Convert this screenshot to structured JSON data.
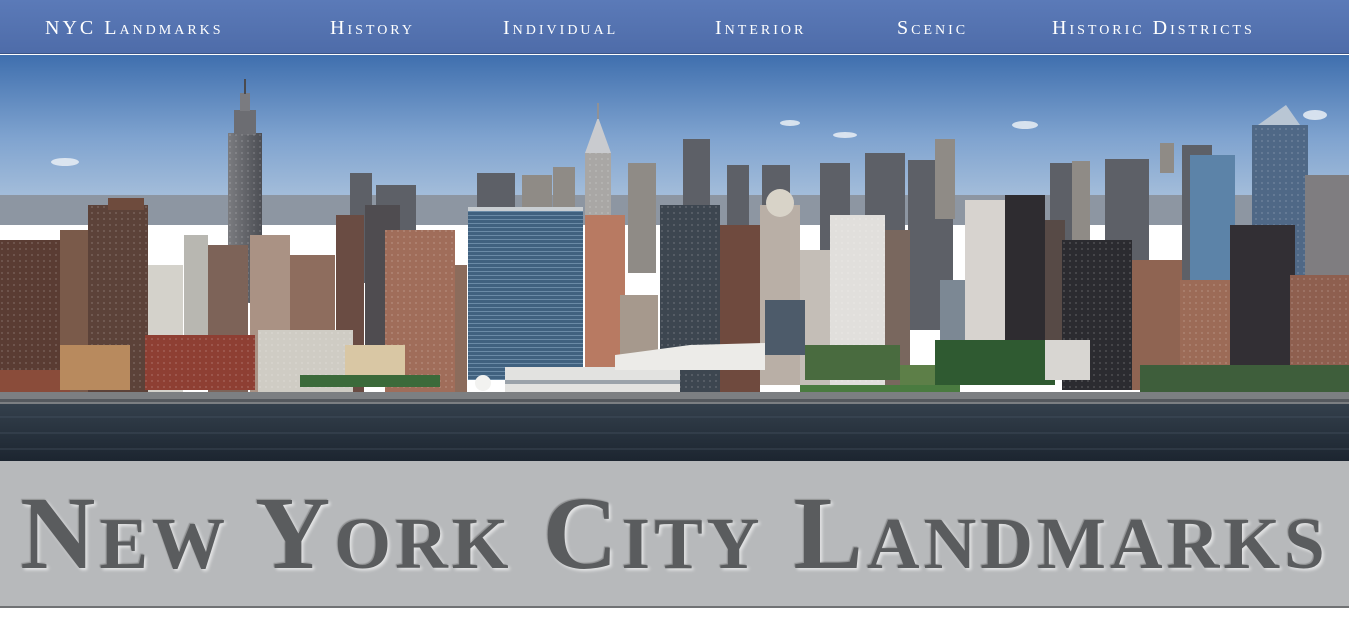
{
  "nav": {
    "items": [
      {
        "label": "NYC Landmarks"
      },
      {
        "label": "History"
      },
      {
        "label": "Individual"
      },
      {
        "label": "Interior"
      },
      {
        "label": "Scenic"
      },
      {
        "label": "Historic Districts"
      }
    ]
  },
  "header": {
    "title": "New York City Landmarks"
  },
  "colors": {
    "nav_bg": "#5474b0",
    "title_band_bg": "#b7b9bb",
    "title_text": "#5a5c5e"
  }
}
